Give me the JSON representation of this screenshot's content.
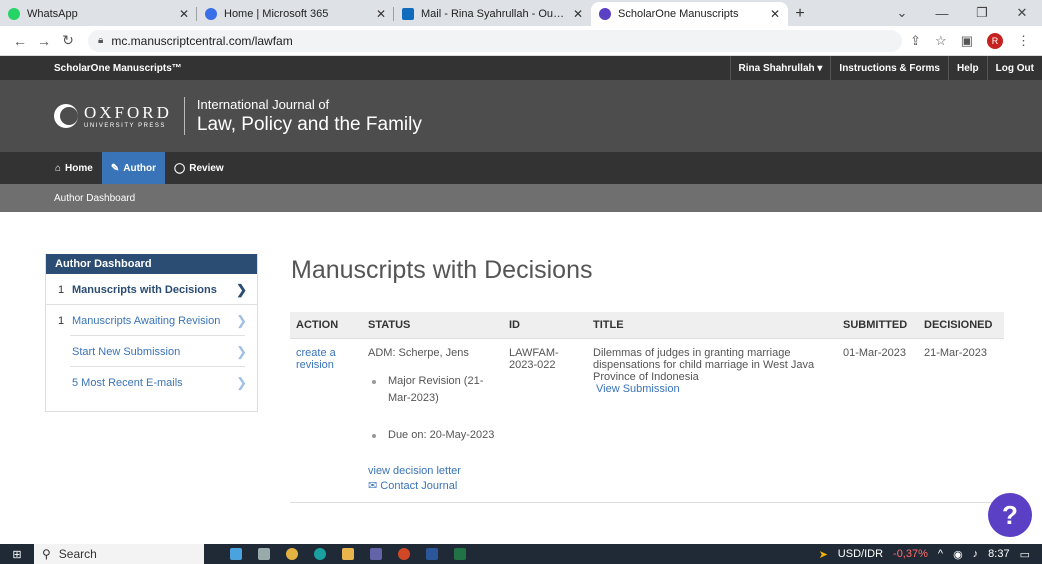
{
  "browser": {
    "tabs": [
      {
        "title": "WhatsApp",
        "color": "#25d366",
        "active": false
      },
      {
        "title": "Home | Microsoft 365",
        "color": "#3a6ee8",
        "active": false
      },
      {
        "title": "Mail - Rina Syahrullah - Outlook",
        "color": "#0f6cbd",
        "active": false
      },
      {
        "title": "ScholarOne Manuscripts",
        "color": "#5b3fc4",
        "active": true
      }
    ],
    "url": "mc.manuscriptcentral.com/lawfam",
    "profile_initial": "R"
  },
  "s1": {
    "brand": "ScholarOne Manuscripts™",
    "user": "Rina Shahrullah ▾",
    "instructions": "Instructions & Forms",
    "help": "Help",
    "logout": "Log Out"
  },
  "journal": {
    "publisher": "OXFORD",
    "publisher_sub": "UNIVERSITY PRESS",
    "title_line1": "International Journal of",
    "title_line2": "Law, Policy and the Family"
  },
  "nav": {
    "home": "Home",
    "author": "Author",
    "review": "Review",
    "sub": "Author Dashboard"
  },
  "sidebar": {
    "header": "Author Dashboard",
    "items": [
      {
        "count": "1",
        "label": "Manuscripts with Decisions"
      },
      {
        "count": "1",
        "label": "Manuscripts Awaiting Revision"
      },
      {
        "count": "",
        "label": "Start New Submission"
      },
      {
        "count": "",
        "label": "5 Most Recent E-mails"
      }
    ]
  },
  "main": {
    "title": "Manuscripts with Decisions",
    "columns": [
      "ACTION",
      "STATUS",
      "ID",
      "TITLE",
      "SUBMITTED",
      "DECISIONED"
    ],
    "row": {
      "action_line1": "create a",
      "action_line2": "revision",
      "status_adm": "ADM: Scherpe, Jens",
      "status_item1": "Major Revision (21-Mar-2023)",
      "status_item2": "Due on: 20-May-2023",
      "decision_letter": "view decision letter",
      "contact": "Contact Journal",
      "id": "LAWFAM-2023-022",
      "title": "Dilemmas of judges in granting marriage dispensations for child marriage in West Java Province of Indonesia",
      "view_submission": "View Submission",
      "submitted": "01-Mar-2023",
      "decisioned": "21-Mar-2023"
    }
  },
  "help_button": "?",
  "taskbar": {
    "search": "Search",
    "currency": "USD/IDR",
    "change": "-0,37%",
    "time": "8:37"
  }
}
